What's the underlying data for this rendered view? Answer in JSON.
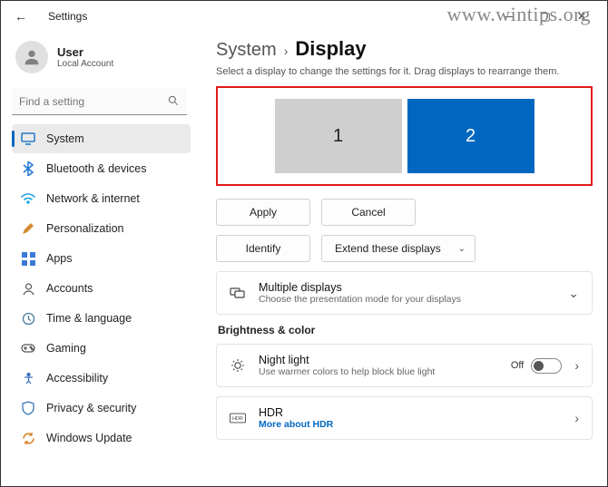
{
  "window": {
    "title": "Settings",
    "watermark": "www.wintips.org"
  },
  "user": {
    "name": "User",
    "subtitle": "Local Account"
  },
  "search": {
    "placeholder": "Find a setting"
  },
  "nav": {
    "system": "System",
    "bluetooth": "Bluetooth & devices",
    "network": "Network & internet",
    "personalization": "Personalization",
    "apps": "Apps",
    "accounts": "Accounts",
    "time": "Time & language",
    "gaming": "Gaming",
    "accessibility": "Accessibility",
    "privacy": "Privacy & security",
    "update": "Windows Update"
  },
  "breadcrumb": {
    "parent": "System",
    "current": "Display"
  },
  "desc": "Select a display to change the settings for it. Drag displays to rearrange them.",
  "monitors": {
    "m1": "1",
    "m2": "2"
  },
  "buttons": {
    "apply": "Apply",
    "cancel": "Cancel",
    "identify": "Identify",
    "extend": "Extend these displays"
  },
  "cards": {
    "multi": {
      "title": "Multiple displays",
      "sub": "Choose the presentation mode for your displays"
    },
    "section_brightness": "Brightness & color",
    "night": {
      "title": "Night light",
      "sub": "Use warmer colors to help block blue light",
      "state": "Off"
    },
    "hdr": {
      "title": "HDR",
      "link": "More about HDR"
    }
  }
}
